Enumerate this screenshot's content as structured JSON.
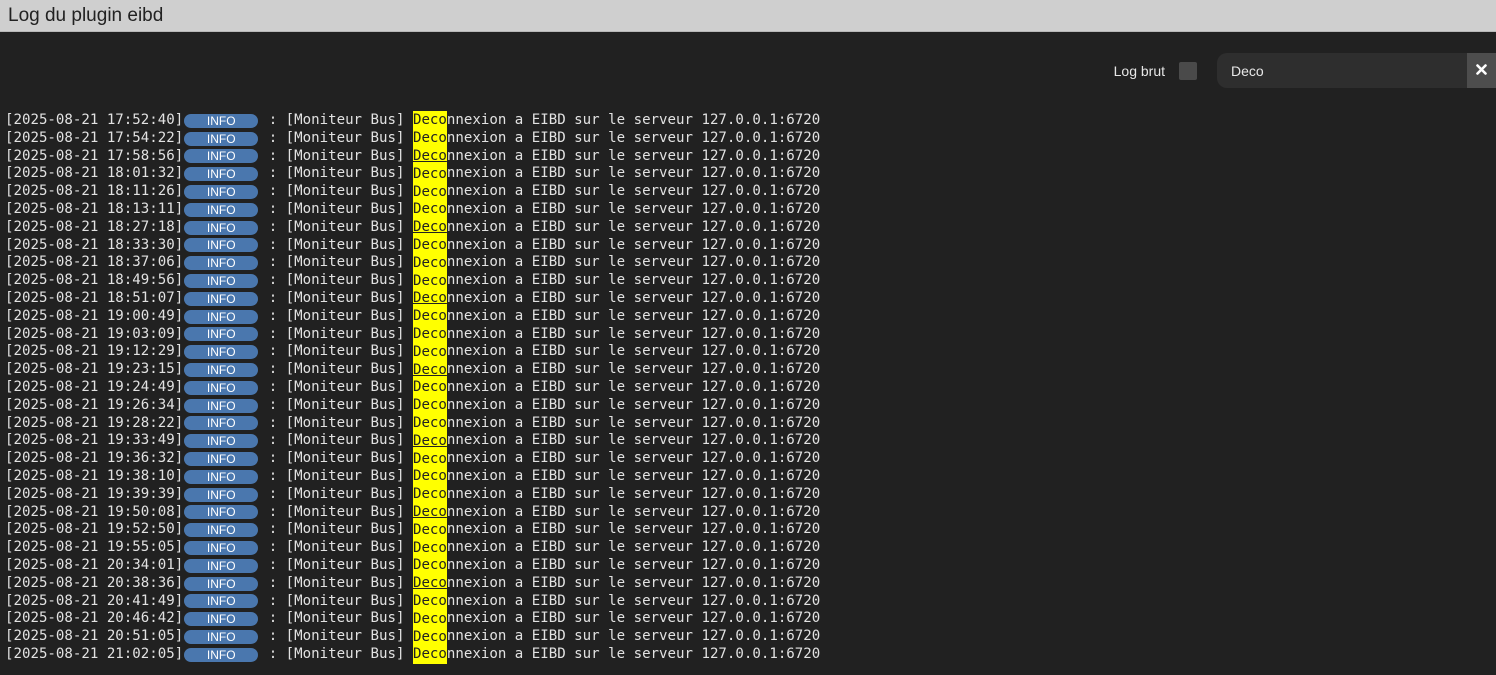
{
  "window": {
    "title": "Log du plugin eibd"
  },
  "toolbar": {
    "raw_label": "Log brut",
    "raw_checked": false,
    "search_value": "Deco",
    "clear_icon": "close-icon"
  },
  "log": {
    "entries": [
      {
        "ts": "[2025-08-21 17:52:40]",
        "level": "INFO",
        "sep": " : ",
        "prefix": "[Moniteur Bus] ",
        "match": "Deco",
        "rest": "nnexion a EIBD sur le serveur 127.0.0.1:6720",
        "cursor": false
      },
      {
        "ts": "[2025-08-21 17:54:22]",
        "level": "INFO",
        "sep": " : ",
        "prefix": "[Moniteur Bus] ",
        "match": "Deco",
        "rest": "nnexion a EIBD sur le serveur 127.0.0.1:6720",
        "cursor": false
      },
      {
        "ts": "[2025-08-21 17:58:56]",
        "level": "INFO",
        "sep": " : ",
        "prefix": "[Moniteur Bus] ",
        "match": "Deco",
        "rest": "nnexion a EIBD sur le serveur 127.0.0.1:6720",
        "cursor": true
      },
      {
        "ts": "[2025-08-21 18:01:32]",
        "level": "INFO",
        "sep": " : ",
        "prefix": "[Moniteur Bus] ",
        "match": "Deco",
        "rest": "nnexion a EIBD sur le serveur 127.0.0.1:6720",
        "cursor": false
      },
      {
        "ts": "[2025-08-21 18:11:26]",
        "level": "INFO",
        "sep": " : ",
        "prefix": "[Moniteur Bus] ",
        "match": "Deco",
        "rest": "nnexion a EIBD sur le serveur 127.0.0.1:6720",
        "cursor": false
      },
      {
        "ts": "[2025-08-21 18:13:11]",
        "level": "INFO",
        "sep": " : ",
        "prefix": "[Moniteur Bus] ",
        "match": "Deco",
        "rest": "nnexion a EIBD sur le serveur 127.0.0.1:6720",
        "cursor": false
      },
      {
        "ts": "[2025-08-21 18:27:18]",
        "level": "INFO",
        "sep": " : ",
        "prefix": "[Moniteur Bus] ",
        "match": "Deco",
        "rest": "nnexion a EIBD sur le serveur 127.0.0.1:6720",
        "cursor": true
      },
      {
        "ts": "[2025-08-21 18:33:30]",
        "level": "INFO",
        "sep": " : ",
        "prefix": "[Moniteur Bus] ",
        "match": "Deco",
        "rest": "nnexion a EIBD sur le serveur 127.0.0.1:6720",
        "cursor": false
      },
      {
        "ts": "[2025-08-21 18:37:06]",
        "level": "INFO",
        "sep": " : ",
        "prefix": "[Moniteur Bus] ",
        "match": "Deco",
        "rest": "nnexion a EIBD sur le serveur 127.0.0.1:6720",
        "cursor": false
      },
      {
        "ts": "[2025-08-21 18:49:56]",
        "level": "INFO",
        "sep": " : ",
        "prefix": "[Moniteur Bus] ",
        "match": "Deco",
        "rest": "nnexion a EIBD sur le serveur 127.0.0.1:6720",
        "cursor": false
      },
      {
        "ts": "[2025-08-21 18:51:07]",
        "level": "INFO",
        "sep": " : ",
        "prefix": "[Moniteur Bus] ",
        "match": "Deco",
        "rest": "nnexion a EIBD sur le serveur 127.0.0.1:6720",
        "cursor": true
      },
      {
        "ts": "[2025-08-21 19:00:49]",
        "level": "INFO",
        "sep": " : ",
        "prefix": "[Moniteur Bus] ",
        "match": "Deco",
        "rest": "nnexion a EIBD sur le serveur 127.0.0.1:6720",
        "cursor": false
      },
      {
        "ts": "[2025-08-21 19:03:09]",
        "level": "INFO",
        "sep": " : ",
        "prefix": "[Moniteur Bus] ",
        "match": "Deco",
        "rest": "nnexion a EIBD sur le serveur 127.0.0.1:6720",
        "cursor": false
      },
      {
        "ts": "[2025-08-21 19:12:29]",
        "level": "INFO",
        "sep": " : ",
        "prefix": "[Moniteur Bus] ",
        "match": "Deco",
        "rest": "nnexion a EIBD sur le serveur 127.0.0.1:6720",
        "cursor": false
      },
      {
        "ts": "[2025-08-21 19:23:15]",
        "level": "INFO",
        "sep": " : ",
        "prefix": "[Moniteur Bus] ",
        "match": "Deco",
        "rest": "nnexion a EIBD sur le serveur 127.0.0.1:6720",
        "cursor": true
      },
      {
        "ts": "[2025-08-21 19:24:49]",
        "level": "INFO",
        "sep": " : ",
        "prefix": "[Moniteur Bus] ",
        "match": "Deco",
        "rest": "nnexion a EIBD sur le serveur 127.0.0.1:6720",
        "cursor": false
      },
      {
        "ts": "[2025-08-21 19:26:34]",
        "level": "INFO",
        "sep": " : ",
        "prefix": "[Moniteur Bus] ",
        "match": "Deco",
        "rest": "nnexion a EIBD sur le serveur 127.0.0.1:6720",
        "cursor": false
      },
      {
        "ts": "[2025-08-21 19:28:22]",
        "level": "INFO",
        "sep": " : ",
        "prefix": "[Moniteur Bus] ",
        "match": "Deco",
        "rest": "nnexion a EIBD sur le serveur 127.0.0.1:6720",
        "cursor": false
      },
      {
        "ts": "[2025-08-21 19:33:49]",
        "level": "INFO",
        "sep": " : ",
        "prefix": "[Moniteur Bus] ",
        "match": "Deco",
        "rest": "nnexion a EIBD sur le serveur 127.0.0.1:6720",
        "cursor": true
      },
      {
        "ts": "[2025-08-21 19:36:32]",
        "level": "INFO",
        "sep": " : ",
        "prefix": "[Moniteur Bus] ",
        "match": "Deco",
        "rest": "nnexion a EIBD sur le serveur 127.0.0.1:6720",
        "cursor": false
      },
      {
        "ts": "[2025-08-21 19:38:10]",
        "level": "INFO",
        "sep": " : ",
        "prefix": "[Moniteur Bus] ",
        "match": "Deco",
        "rest": "nnexion a EIBD sur le serveur 127.0.0.1:6720",
        "cursor": false
      },
      {
        "ts": "[2025-08-21 19:39:39]",
        "level": "INFO",
        "sep": " : ",
        "prefix": "[Moniteur Bus] ",
        "match": "Deco",
        "rest": "nnexion a EIBD sur le serveur 127.0.0.1:6720",
        "cursor": false
      },
      {
        "ts": "[2025-08-21 19:50:08]",
        "level": "INFO",
        "sep": " : ",
        "prefix": "[Moniteur Bus] ",
        "match": "Deco",
        "rest": "nnexion a EIBD sur le serveur 127.0.0.1:6720",
        "cursor": true
      },
      {
        "ts": "[2025-08-21 19:52:50]",
        "level": "INFO",
        "sep": " : ",
        "prefix": "[Moniteur Bus] ",
        "match": "Deco",
        "rest": "nnexion a EIBD sur le serveur 127.0.0.1:6720",
        "cursor": false
      },
      {
        "ts": "[2025-08-21 19:55:05]",
        "level": "INFO",
        "sep": " : ",
        "prefix": "[Moniteur Bus] ",
        "match": "Deco",
        "rest": "nnexion a EIBD sur le serveur 127.0.0.1:6720",
        "cursor": false
      },
      {
        "ts": "[2025-08-21 20:34:01]",
        "level": "INFO",
        "sep": " : ",
        "prefix": "[Moniteur Bus] ",
        "match": "Deco",
        "rest": "nnexion a EIBD sur le serveur 127.0.0.1:6720",
        "cursor": false
      },
      {
        "ts": "[2025-08-21 20:38:36]",
        "level": "INFO",
        "sep": " : ",
        "prefix": "[Moniteur Bus] ",
        "match": "Deco",
        "rest": "nnexion a EIBD sur le serveur 127.0.0.1:6720",
        "cursor": true
      },
      {
        "ts": "[2025-08-21 20:41:49]",
        "level": "INFO",
        "sep": " : ",
        "prefix": "[Moniteur Bus] ",
        "match": "Deco",
        "rest": "nnexion a EIBD sur le serveur 127.0.0.1:6720",
        "cursor": false
      },
      {
        "ts": "[2025-08-21 20:46:42]",
        "level": "INFO",
        "sep": " : ",
        "prefix": "[Moniteur Bus] ",
        "match": "Deco",
        "rest": "nnexion a EIBD sur le serveur 127.0.0.1:6720",
        "cursor": false
      },
      {
        "ts": "[2025-08-21 20:51:05]",
        "level": "INFO",
        "sep": " : ",
        "prefix": "[Moniteur Bus] ",
        "match": "Deco",
        "rest": "nnexion a EIBD sur le serveur 127.0.0.1:6720",
        "cursor": false
      },
      {
        "ts": "[2025-08-21 21:02:05]",
        "level": "INFO",
        "sep": " : ",
        "prefix": "[Moniteur Bus] ",
        "match": "Deco",
        "rest": "nnexion a EIBD sur le serveur 127.0.0.1:6720",
        "cursor": false
      }
    ]
  },
  "colors": {
    "background": "#212121",
    "titlebar": "#cfcfcf",
    "info_badge": "#4a77ae",
    "highlight": "#ffff00"
  }
}
